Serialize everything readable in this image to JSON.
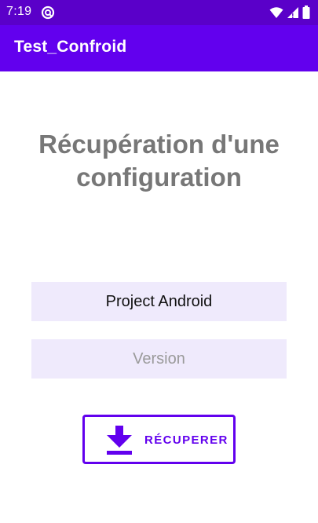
{
  "status_bar": {
    "time": "7:19",
    "icons": [
      "app-notification-icon",
      "wifi-icon",
      "cellular-signal-icon",
      "battery-icon"
    ]
  },
  "app_bar": {
    "title": "Test_Confroid"
  },
  "main": {
    "title": "Récupération d'une configuration",
    "project_field": {
      "value": "Project Android"
    },
    "version_field": {
      "value": "",
      "placeholder": "Version"
    },
    "recover_button": {
      "label": "RÉCUPERER",
      "icon": "download-icon"
    }
  },
  "colors": {
    "status_bar": "#5a00c9",
    "primary": "#6200ee",
    "field_background": "#efeafc",
    "title_text": "#777777",
    "placeholder_text": "#9a9a9a"
  }
}
